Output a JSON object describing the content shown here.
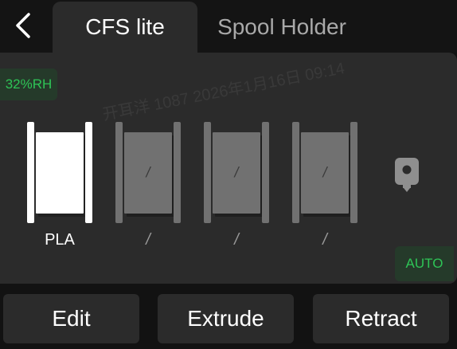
{
  "header": {
    "back_icon": "chevron-left-icon",
    "tabs": [
      {
        "label": "CFS lite",
        "active": true
      },
      {
        "label": "Spool Holder",
        "active": false
      }
    ]
  },
  "panel": {
    "humidity": "32%RH",
    "slots": [
      {
        "filament": "PLA",
        "loaded": true,
        "color": "#ffffff",
        "core_label": ""
      },
      {
        "filament": "/",
        "loaded": false,
        "color": "#717171",
        "core_label": "/"
      },
      {
        "filament": "/",
        "loaded": false,
        "color": "#717171",
        "core_label": "/"
      },
      {
        "filament": "/",
        "loaded": false,
        "color": "#717171",
        "core_label": "/"
      }
    ],
    "extruder_icon": "extruder-icon",
    "mode_badge": "AUTO"
  },
  "actions": {
    "edit": "Edit",
    "extrude": "Extrude",
    "retract": "Retract"
  },
  "watermark": "开耳洋 1087 2026年1月16日 09:14",
  "colors": {
    "background": "#121212",
    "panel": "#2b2b2b",
    "accent_green": "#2ec456",
    "badge_bg": "#253a2a",
    "inactive_text": "#a9a9a9"
  }
}
